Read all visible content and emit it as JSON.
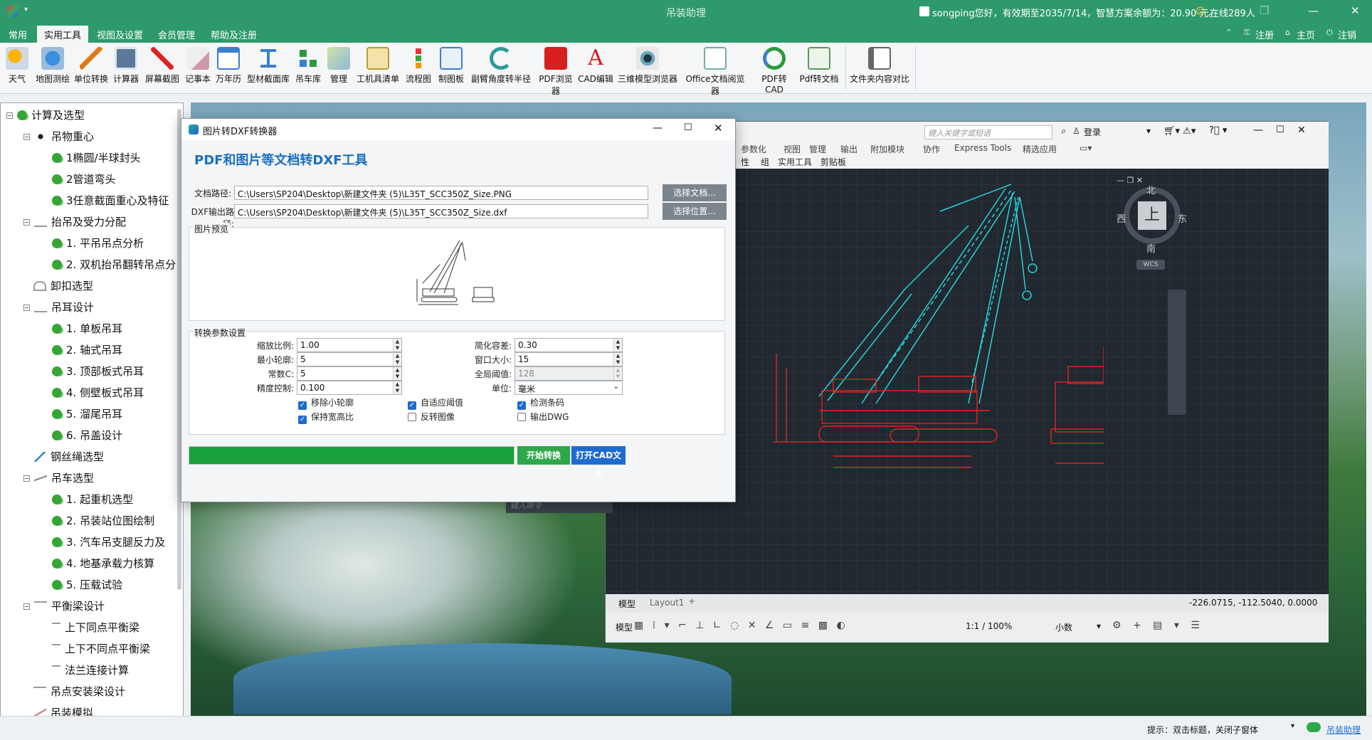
{
  "title_bar": {
    "title": "吊装助理",
    "account_info": "songping您好，有效期至2035/7/14，智慧方案余额为：20.90 元。",
    "online": "在线289人"
  },
  "menu": {
    "items": [
      "常用",
      "实用工具",
      "视图及设置",
      "会员管理",
      "帮助及注册"
    ],
    "active": "实用工具",
    "right_items": [
      "注册",
      "主页",
      "注销"
    ]
  },
  "toolbar": {
    "tools": [
      "天气",
      "地图测绘",
      "单位转换",
      "计算器",
      "屏幕截图",
      "记事本",
      "万年历",
      "型材截面库",
      "吊车库",
      "管理",
      "工机具清单",
      "流程图",
      "制图板",
      "副臂角度转半径",
      "PDF浏览器",
      "CAD编辑",
      "三维模型浏览器",
      "Office文档阅览器",
      "PDF转CAD",
      "Pdf转文档",
      "文件夹内容对比"
    ]
  },
  "sidebar": {
    "items": [
      "计算及选型",
      "吊物重心",
      "1椭圆/半球封头",
      "2管道弯头",
      "3任意截面重心及特征",
      "抬吊及受力分配",
      "1. 平吊吊点分析",
      "2. 双机抬吊翻转吊点分",
      "卸扣选型",
      "吊耳设计",
      "1. 单板吊耳",
      "2. 轴式吊耳",
      "3. 顶部板式吊耳",
      "4. 侧壁板式吊耳",
      "5. 溜尾吊耳",
      "6. 吊盖设计",
      "钢丝绳选型",
      "吊车选型",
      "1. 起重机选型",
      "2. 吊装站位图绘制",
      "3. 汽车吊支腿反力及",
      "4. 地基承载力核算",
      "5. 压载试验",
      "平衡梁设计",
      "上下同点平衡梁",
      "上下不同点平衡梁",
      "法兰连接计算",
      "吊点安装梁设计",
      "吊装模拟"
    ]
  },
  "dialog": {
    "window_title": "图片转DXF转换器",
    "heading": "PDF和图片等文档转DXF工具",
    "doc_path_label": "文档路径:",
    "doc_path": "C:\\Users\\SP204\\Desktop\\新建文件夹 (5)\\L35T_SCC350Z_Size.PNG",
    "doc_btn": "选择文档...",
    "dxf_path_label": "DXF输出路径:",
    "dxf_path": "C:\\Users\\SP204\\Desktop\\新建文件夹 (5)\\L35T_SCC350Z_Size.dxf",
    "dxf_btn": "选择位置...",
    "preview_label": "图片预览",
    "params_label": "转换参数设置",
    "scale_label": "缩放比例:",
    "scale": "1.00",
    "min_contour_label": "最小轮廓:",
    "min_contour": "5",
    "const_c_label": "常数C:",
    "const_c": "5",
    "precision_label": "精度控制:",
    "precision": "0.100",
    "simplify_label": "简化容差:",
    "simplify": "0.30",
    "window_label": "窗口大小:",
    "window": "15",
    "global_label": "全局阈值:",
    "global": "128",
    "unit_label": "单位:",
    "unit": "毫米",
    "chk_remove_small": "移除小轮廓",
    "chk_adaptive": "自适应阈值",
    "chk_barcode": "检测条码",
    "chk_keep_ratio": "保持宽高比",
    "chk_invert": "反转图像",
    "chk_dwg": "输出DWG",
    "progress": 1.0,
    "start_btn": "开始转换",
    "open_cad_btn": "打开CAD文件"
  },
  "cad": {
    "search_placeholder": "键入关键字或短语",
    "login": "登录",
    "ribbon_tabs": [
      "参数化",
      "视图",
      "管理",
      "输出",
      "附加模块",
      "协作",
      "Express Tools",
      "精选应用"
    ],
    "panel_tabs": [
      "性",
      "组",
      "实用工具",
      "剪贴板"
    ],
    "viewcube": {
      "north": "北",
      "south": "南",
      "west": "西",
      "east": "东",
      "top": "上",
      "wcs": "WCS"
    },
    "layout_tabs": [
      "模型",
      "Layout1"
    ],
    "coords": "-226.0715, -112.5040, 0.0000",
    "status_model": "模型",
    "scale": "1:1 / 100%",
    "units": "小数",
    "cmd_placeholder": "键入命令"
  },
  "status": {
    "hint": "提示：双击标题，关闭子窗体",
    "app": "吊装助理"
  },
  "colors": {
    "brand": "#2e9a6b",
    "progress": "#18a03a",
    "start_btn": "#2ea84a",
    "open_btn": "#1e6bd0",
    "cad_cyan": "#27d3d8",
    "cad_red": "#e02424"
  }
}
